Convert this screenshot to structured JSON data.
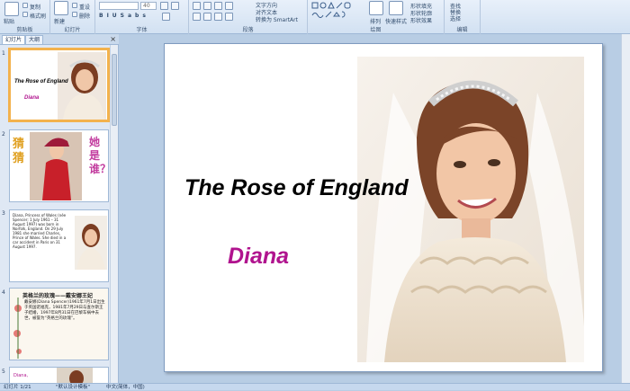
{
  "ribbon": {
    "groups": {
      "clipboard": "剪贴板",
      "slides": "幻灯片",
      "font": "字体",
      "paragraph": "段落",
      "drawing": "绘图",
      "editing": "编辑"
    },
    "clipboard": {
      "paste": "粘贴",
      "copy": "复制",
      "format_painter": "格式刷"
    },
    "slides": {
      "new_slide": "新建",
      "new_slide2": "幻灯片",
      "reset": "重设",
      "delete": "删除"
    },
    "font": {
      "size": "40"
    },
    "paragraph": {
      "text_direction": "文字方向",
      "align_text": "对齐文本",
      "smartart": "转换为 SmartArt"
    },
    "drawing": {
      "arrange": "排列",
      "quick_styles": "快速样式",
      "shape_fill": "形状填充",
      "shape_outline": "形状轮廓",
      "shape_effects": "形状效果"
    },
    "editing": {
      "find": "查找",
      "replace": "替换",
      "select": "选择"
    }
  },
  "left_pane": {
    "tabs": [
      "幻灯片",
      "大纲"
    ],
    "close": "×",
    "slide_numbers": [
      "1",
      "2",
      "3",
      "4",
      "5"
    ],
    "thumb1": {
      "title": "The Rose of England",
      "subtitle": "Diana"
    },
    "thumb2": {
      "left_chars": "猜猜",
      "right_chars": "她是谁？"
    },
    "thumb3": {
      "text": "Diana, Princess of Wales (née Spencer; 1 July 1961 – 31 August 1997) was born in Norfolk, England. On 29 July 1981 she married Charles, Prince of Wales. She died in a car accident in Paris on 31 August 1997."
    },
    "thumb4": {
      "heading": "英格兰的玫瑰——戴安娜王妃",
      "text": "戴安娜(Diana Spencer)1961年7月1日出生于英国诺福克，1981年7月29日与查尔斯王子结婚，1997年8月31日在巴黎车祸中去世，被誉为“英格兰的玫瑰”。"
    },
    "thumb5": {
      "text": "Diana,"
    }
  },
  "slide": {
    "title": "The Rose of England",
    "subtitle": "Diana"
  },
  "status": {
    "slide_info": "幻灯片 1/21",
    "theme": "\"默认设计模板\"",
    "language": "中文(简体，中国)"
  },
  "colors": {
    "subtitle": "#b0138e",
    "selection": "#f3b24d",
    "ribbon": "#d2e1f2"
  }
}
